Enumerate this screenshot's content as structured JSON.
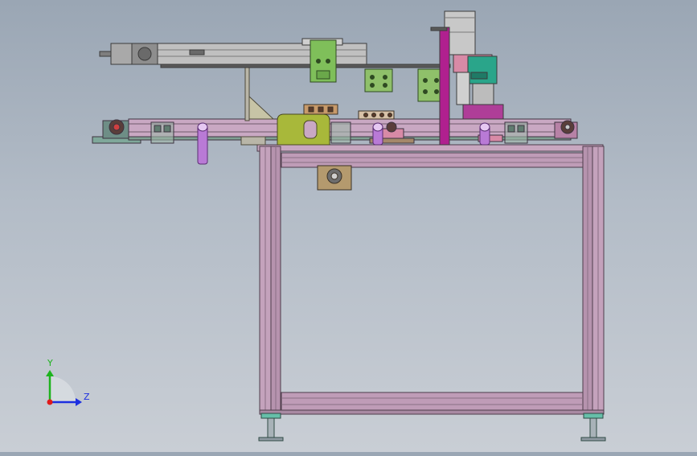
{
  "triad": {
    "y_label": "Y",
    "z_label": "Z",
    "y_color": "#1db31d",
    "z_color": "#1c2fe0",
    "origin_color": "#e01a1a"
  },
  "colors": {
    "frame": "#b898b0",
    "frame_edge": "#5e4a5a",
    "belt": "#c9a8c3",
    "green_plate": "#7fbf5a",
    "yellow_green_block": "#a8b83a",
    "magenta_post": "#b0208f",
    "cylinder": "#b97ad6",
    "pink_bracket": "#d88aa6",
    "teal_block": "#2aa58a",
    "foot": "#66bfa9"
  }
}
